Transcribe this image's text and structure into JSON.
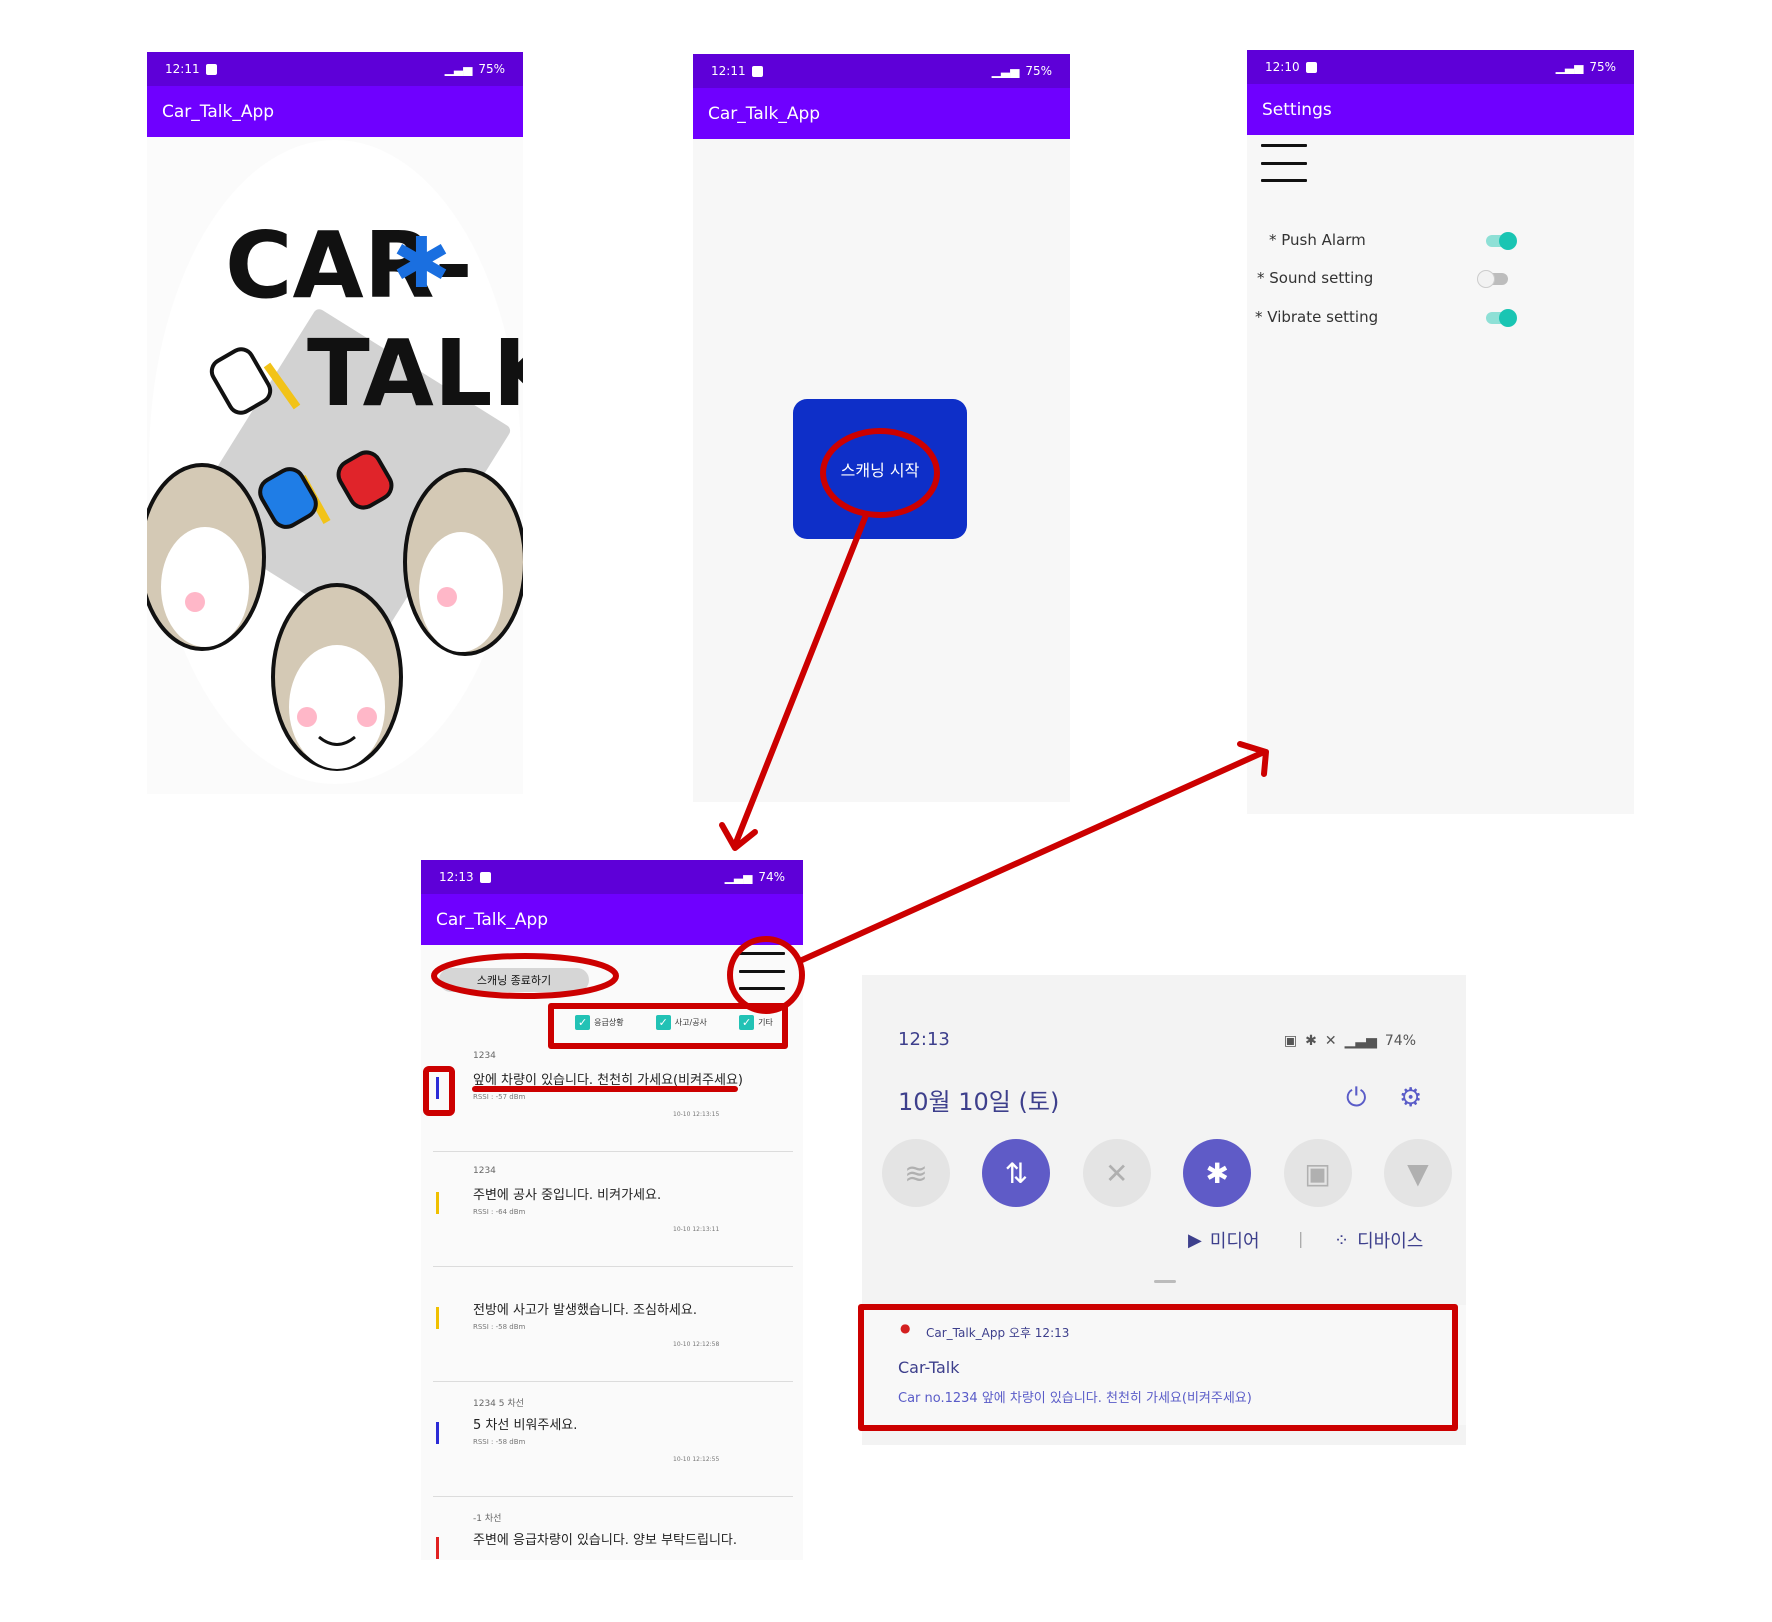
{
  "logo_screen": {
    "status": {
      "time": "12:11",
      "battery": "75%"
    },
    "app_title": "Car_Talk_App",
    "logo": {
      "line1": "CAR-",
      "line2": "TALK"
    }
  },
  "scan_screen": {
    "status": {
      "time": "12:11",
      "battery": "75%"
    },
    "app_title": "Car_Talk_App",
    "scan_button": "스캐닝 시작"
  },
  "settings_screen": {
    "status": {
      "time": "12:10",
      "battery": "75%"
    },
    "title": "Settings",
    "items": [
      {
        "label": "* Push Alarm",
        "on": true
      },
      {
        "label": "* Sound setting",
        "on": false
      },
      {
        "label": "* Vibrate setting",
        "on": true
      }
    ]
  },
  "list_screen": {
    "status": {
      "time": "12:13",
      "battery": "74%"
    },
    "app_title": "Car_Talk_App",
    "stop_button": "스캐닝 종료하기",
    "filters": [
      "응급상황",
      "사고/공사",
      "기타"
    ],
    "messages": [
      {
        "id": "1234",
        "text": "앞에 차량이 있습니다. 천천히 가세요(비켜주세요)",
        "rssi": "RSSI : -57 dBm",
        "time": "10-10 12:13:15",
        "color": "#2b2bd6"
      },
      {
        "id": "1234",
        "text": "주변에 공사 중입니다. 비켜가세요.",
        "rssi": "RSSI : -64 dBm",
        "time": "10-10 12:13:11",
        "color": "#f0c000"
      },
      {
        "id": "",
        "text": "전방에 사고가 발생했습니다. 조심하세요.",
        "rssi": "RSSI : -58 dBm",
        "time": "10-10 12:12:58",
        "color": "#f0c000"
      },
      {
        "id": "1234   5 차선",
        "text": "5 차선 비워주세요.",
        "rssi": "RSSI : -58 dBm",
        "time": "10-10 12:12:55",
        "color": "#2b2bd6"
      },
      {
        "id": "-1 차선",
        "text": "주변에 응급차량이 있습니다. 양보 부탁드립니다.",
        "rssi": "",
        "time": "",
        "color": "#e02020"
      }
    ]
  },
  "notification_panel": {
    "time": "12:13",
    "battery": "74%",
    "date": "10월 10일 (토)",
    "quick_settings": [
      "wifi-icon",
      "data-icon",
      "mute-icon",
      "bluetooth-icon",
      "lock-icon",
      "flashlight-icon"
    ],
    "media_label": "미디어",
    "devices_label": "디바이스",
    "notification": {
      "app": "Car_Talk_App  오후 12:13",
      "title": "Car-Talk",
      "body": "Car no.1234 앞에 차량이 있습니다. 천천히 가세요(비켜주세요)"
    }
  },
  "colors": {
    "status_bar": "#5e00d8",
    "app_bar": "#6f00ff",
    "annotation": "#cc0000",
    "scan_button": "#0e2fc8",
    "toggle_on": "#1ac5b3"
  }
}
